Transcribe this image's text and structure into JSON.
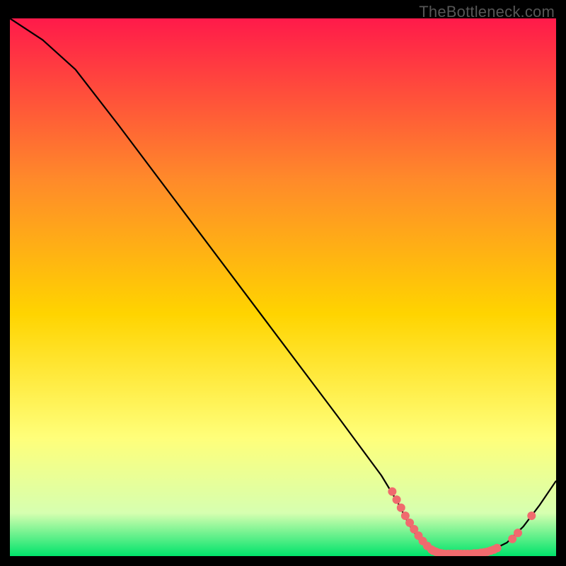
{
  "watermark": "TheBottleneck.com",
  "chart_data": {
    "type": "line",
    "title": "",
    "xlabel": "",
    "ylabel": "",
    "xlim": [
      0,
      100
    ],
    "ylim": [
      0,
      100
    ],
    "background_gradient": {
      "top": "#ff1a4a",
      "upper_mid": "#ff8a2a",
      "mid": "#ffd400",
      "lower_mid": "#ffff7a",
      "near_bottom": "#d6ffb0",
      "bottom": "#00e36b"
    },
    "curve": [
      {
        "x": 0,
        "y": 100
      },
      {
        "x": 6,
        "y": 96
      },
      {
        "x": 12,
        "y": 90.5
      },
      {
        "x": 20,
        "y": 80
      },
      {
        "x": 30,
        "y": 66.5
      },
      {
        "x": 40,
        "y": 53
      },
      {
        "x": 50,
        "y": 39.5
      },
      {
        "x": 60,
        "y": 26
      },
      {
        "x": 68,
        "y": 15
      },
      {
        "x": 71,
        "y": 10
      },
      {
        "x": 73,
        "y": 6
      },
      {
        "x": 75,
        "y": 3
      },
      {
        "x": 77,
        "y": 1.2
      },
      {
        "x": 80,
        "y": 0.4
      },
      {
        "x": 84,
        "y": 0.4
      },
      {
        "x": 88,
        "y": 1.0
      },
      {
        "x": 91,
        "y": 2.5
      },
      {
        "x": 94,
        "y": 5.5
      },
      {
        "x": 97,
        "y": 9.5
      },
      {
        "x": 100,
        "y": 14
      }
    ],
    "marker_points": [
      {
        "x": 70.0,
        "y": 12.0
      },
      {
        "x": 70.8,
        "y": 10.5
      },
      {
        "x": 71.6,
        "y": 9.0
      },
      {
        "x": 72.4,
        "y": 7.5
      },
      {
        "x": 73.2,
        "y": 6.2
      },
      {
        "x": 74.0,
        "y": 5.0
      },
      {
        "x": 74.8,
        "y": 3.8
      },
      {
        "x": 75.6,
        "y": 2.8
      },
      {
        "x": 76.4,
        "y": 1.9
      },
      {
        "x": 77.2,
        "y": 1.2
      },
      {
        "x": 77.5,
        "y": 1.0
      },
      {
        "x": 78.0,
        "y": 0.8
      },
      {
        "x": 78.5,
        "y": 0.6
      },
      {
        "x": 79.0,
        "y": 0.5
      },
      {
        "x": 79.6,
        "y": 0.4
      },
      {
        "x": 80.2,
        "y": 0.4
      },
      {
        "x": 80.8,
        "y": 0.4
      },
      {
        "x": 81.4,
        "y": 0.4
      },
      {
        "x": 82.0,
        "y": 0.4
      },
      {
        "x": 82.6,
        "y": 0.4
      },
      {
        "x": 83.2,
        "y": 0.4
      },
      {
        "x": 83.8,
        "y": 0.4
      },
      {
        "x": 84.4,
        "y": 0.4
      },
      {
        "x": 85.0,
        "y": 0.5
      },
      {
        "x": 85.6,
        "y": 0.5
      },
      {
        "x": 86.2,
        "y": 0.6
      },
      {
        "x": 86.8,
        "y": 0.7
      },
      {
        "x": 87.4,
        "y": 0.8
      },
      {
        "x": 88.0,
        "y": 1.0
      },
      {
        "x": 88.6,
        "y": 1.2
      },
      {
        "x": 89.2,
        "y": 1.5
      },
      {
        "x": 92.0,
        "y": 3.2
      },
      {
        "x": 93.0,
        "y": 4.3
      },
      {
        "x": 95.5,
        "y": 7.5
      }
    ],
    "marker_color": "#f06a6e",
    "marker_radius": 6
  }
}
